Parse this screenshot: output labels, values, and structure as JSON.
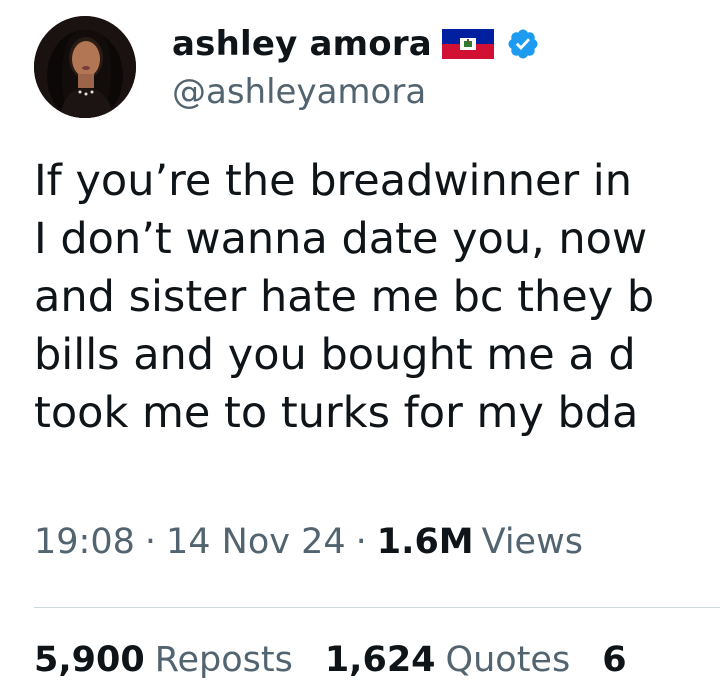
{
  "author": {
    "display_name": "ashley amora",
    "handle": "@ashleyamora",
    "flag_icon": "haiti-flag-icon",
    "verified_icon": "verified-badge-icon",
    "verified_color": "#1d9bf0"
  },
  "tweet": {
    "lines": [
      "If you’re the breadwinner in",
      "I don’t wanna date you, now",
      "and sister hate me bc they b",
      "bills and you bought me a d",
      "took me to turks for my bda"
    ],
    "time": "19:08",
    "separator": "·",
    "date": "14 Nov 24",
    "views_count": "1.6M",
    "views_label": "Views"
  },
  "stats": {
    "reposts_count": "5,900",
    "reposts_label": "Reposts",
    "quotes_count": "1,624",
    "quotes_label": "Quotes",
    "third_count_partial": "6"
  },
  "colors": {
    "text_primary": "#0f1419",
    "text_secondary": "#536471",
    "divider": "#cfd9de",
    "flag_blue": "#00209f",
    "flag_red": "#d21034"
  }
}
